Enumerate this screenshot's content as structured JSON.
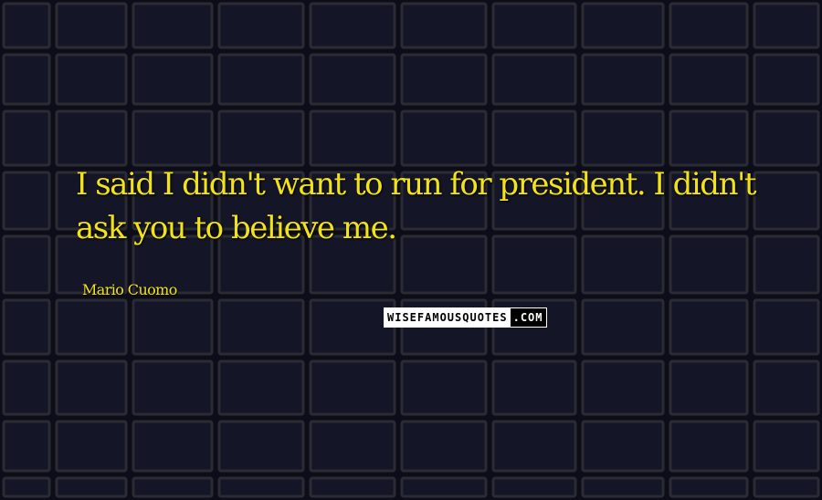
{
  "quote": {
    "text": "I said I didn't want to run for president. I didn't ask you to believe me.",
    "author": "Mario Cuomo",
    "color": "#f2e21a"
  },
  "watermark": {
    "part1": "WISEFAMOUSQUOTES",
    "part2": ".COM"
  },
  "background": {
    "description_icon": "solar-panel-grid",
    "panel_color": "#141628",
    "frame_color": "#2a2b33"
  }
}
